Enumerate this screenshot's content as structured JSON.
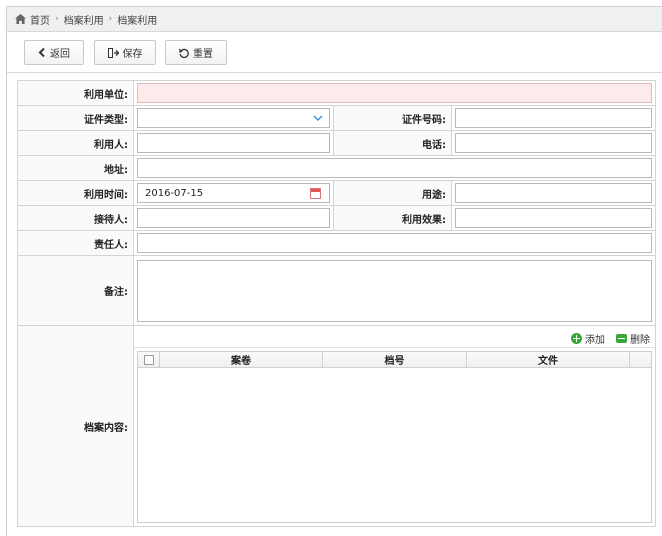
{
  "breadcrumb": {
    "items": [
      "首页",
      "档案利用",
      "档案利用"
    ]
  },
  "toolbar": {
    "back_label": "返回",
    "save_label": "保存",
    "reset_label": "重置"
  },
  "form": {
    "unit_label": "利用单位:",
    "unit_value": "",
    "id_type_label": "证件类型:",
    "id_type_value": "",
    "id_number_label": "证件号码:",
    "id_number_value": "",
    "user_label": "利用人:",
    "user_value": "",
    "phone_label": "电话:",
    "phone_value": "",
    "address_label": "地址:",
    "address_value": "",
    "time_label": "利用时间:",
    "time_value": "2016-07-15",
    "purpose_label": "用途:",
    "purpose_value": "",
    "receiver_label": "接待人:",
    "receiver_value": "",
    "effect_label": "利用效果:",
    "effect_value": "",
    "responsible_label": "责任人:",
    "responsible_value": "",
    "remarks_label": "备注:",
    "remarks_value": "",
    "contents_label": "档案内容:"
  },
  "contents": {
    "add_label": "添加",
    "delete_label": "删除",
    "columns": [
      "案卷",
      "档号",
      "文件"
    ]
  },
  "colors": {
    "required_bg": "#fdeaea",
    "add_icon": "#3aa63a",
    "calendar": "#d55555"
  },
  "icons": [
    "home-icon",
    "back-icon",
    "save-icon",
    "reset-icon",
    "chevron-down-icon",
    "calendar-icon",
    "add-icon",
    "remove-icon"
  ]
}
